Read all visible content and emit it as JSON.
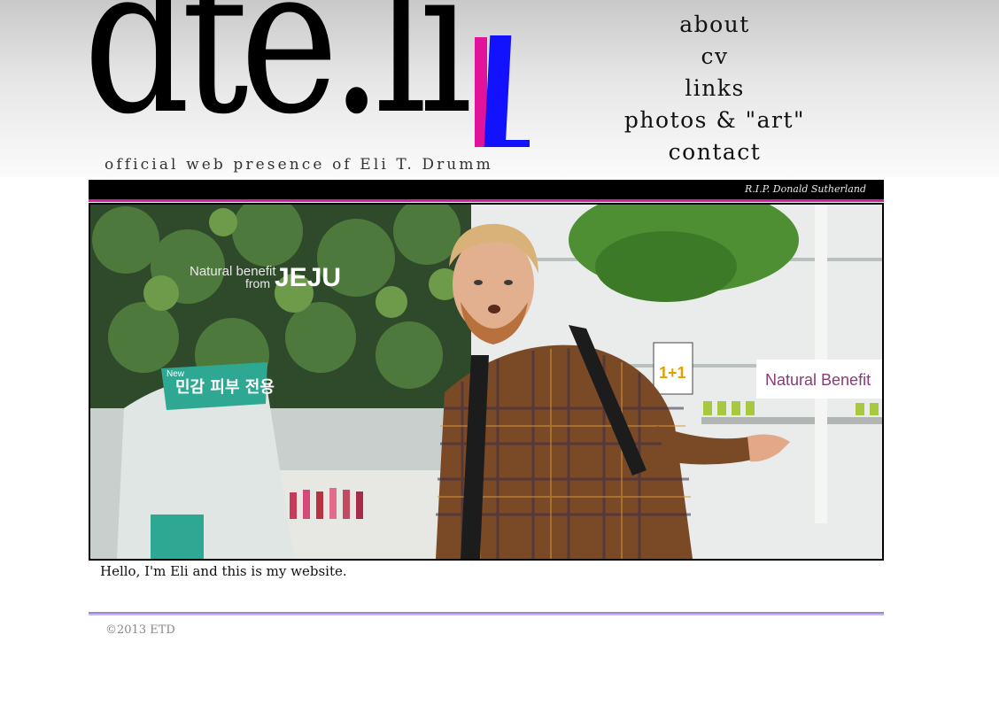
{
  "logo": {
    "text": "dte.li",
    "colors": {
      "pink": "#e0139a",
      "blue": "#1212ff"
    }
  },
  "tagline": "official web presence of Eli T. Drumm",
  "nav": {
    "items": [
      {
        "label": "about"
      },
      {
        "label": "cv"
      },
      {
        "label": "links"
      },
      {
        "label": "photos & \"art\""
      },
      {
        "label": "contact"
      }
    ]
  },
  "banner": {
    "text": "R.I.P. Donald Sutherland",
    "colors": {
      "background": "#000000",
      "accent": "#d61e9d"
    }
  },
  "photo": {
    "signs": {
      "store_line1": "Natural benefit",
      "store_line2": "from",
      "store_brand": "JEJU",
      "counter_sign": "Natural Benefit",
      "display_korean": "민감 피부 전용",
      "display_new": "New",
      "price_tag": "1+1"
    }
  },
  "greeting": "Hello, I'm Eli and this is my website.",
  "footer": {
    "copyright": "©2013 ETD",
    "rule_color": "#9f86d6"
  }
}
